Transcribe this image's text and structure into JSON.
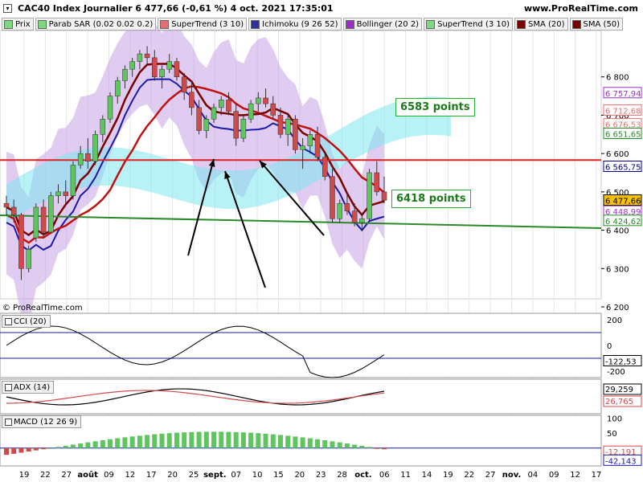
{
  "header": {
    "title": "CAC40 Index Journalier 6 477,66 (-0,61 %) 4 oct. 2021 17:35:01",
    "site": "www.ProRealTime.com",
    "copyright": "© ProRealTime.com"
  },
  "legend": [
    {
      "label": "Prix",
      "color": "#7fd87f"
    },
    {
      "label": "Parab SAR (0.02 0.02 0.2)",
      "color": "#7fd87f"
    },
    {
      "label": "SuperTrend (3 10)",
      "color": "#e07070"
    },
    {
      "label": "Ichimoku (9 26 52)",
      "color": "#3030a0"
    },
    {
      "label": "Bollinger (20 2)",
      "color": "#9b30c8"
    },
    {
      "label": "SuperTrend (3 10)",
      "color": "#7fd87f"
    },
    {
      "label": "SMA (20)",
      "color": "#7a0000"
    },
    {
      "label": "SMA (50)",
      "color": "#7a0000"
    }
  ],
  "colors": {
    "up": "#5fc55f",
    "down": "#d04a4a",
    "kumo_bull": "#7ee8ee",
    "kumo_bear": "#c080d8",
    "bollinger": "#c7a0e6",
    "support_green": "#2a8a2a",
    "resistance_red": "#dd2222",
    "arrow": "#000000"
  },
  "annotations": {
    "resistance_label": "6583 points",
    "support_label": "6418 points"
  },
  "chart_data": {
    "type": "candlestick",
    "ylim": [
      6200,
      6900
    ],
    "y_ticks": [
      "6 800",
      "6 700",
      "6 600",
      "6 500",
      "6 400",
      "6 300",
      "6 200"
    ],
    "x_ticks": [
      "19",
      "22",
      "27",
      "août",
      "09",
      "12",
      "17",
      "20",
      "25",
      "sept.",
      "07",
      "10",
      "15",
      "20",
      "23",
      "28",
      "oct.",
      "06",
      "11",
      "14",
      "19",
      "22",
      "27",
      "nov.",
      "04",
      "09",
      "12",
      "17"
    ],
    "price_tags": [
      {
        "label": "6 757,94",
        "value": 6757.94,
        "color": "#9b30c8"
      },
      {
        "label": "6 712,68",
        "value": 6712.68,
        "color": "#e07070"
      },
      {
        "label": "6 676,53",
        "value": 6676.53,
        "color": "#e07070"
      },
      {
        "label": "6 651,65",
        "value": 6651.65,
        "color": "#2a8a2a"
      },
      {
        "label": "6 565,75",
        "value": 6565.75,
        "color": "#000080"
      },
      {
        "label": "6 477,66",
        "value": 6477.66,
        "color": "#000000",
        "highlight": true
      },
      {
        "label": "6 448,99",
        "value": 6448.99,
        "color": "#9b30c8"
      },
      {
        "label": "6 424,62",
        "value": 6424.62,
        "color": "#2a8a2a"
      }
    ],
    "levels": {
      "resistance": 6583,
      "support": 6418
    },
    "candles": [
      [
        6470,
        6490,
        6440,
        6460
      ],
      [
        6460,
        6480,
        6420,
        6440
      ],
      [
        6440,
        6445,
        6270,
        6300
      ],
      [
        6300,
        6360,
        6290,
        6350
      ],
      [
        6380,
        6470,
        6370,
        6460
      ],
      [
        6460,
        6480,
        6380,
        6395
      ],
      [
        6395,
        6500,
        6390,
        6490
      ],
      [
        6490,
        6520,
        6470,
        6500
      ],
      [
        6500,
        6530,
        6470,
        6490
      ],
      [
        6490,
        6580,
        6480,
        6570
      ],
      [
        6570,
        6620,
        6560,
        6600
      ],
      [
        6600,
        6640,
        6560,
        6580
      ],
      [
        6580,
        6660,
        6570,
        6650
      ],
      [
        6650,
        6700,
        6630,
        6690
      ],
      [
        6690,
        6760,
        6680,
        6750
      ],
      [
        6750,
        6800,
        6730,
        6790
      ],
      [
        6790,
        6830,
        6770,
        6820
      ],
      [
        6820,
        6850,
        6800,
        6840
      ],
      [
        6840,
        6870,
        6820,
        6860
      ],
      [
        6860,
        6880,
        6830,
        6850
      ],
      [
        6850,
        6870,
        6790,
        6800
      ],
      [
        6800,
        6830,
        6770,
        6820
      ],
      [
        6820,
        6860,
        6810,
        6840
      ],
      [
        6840,
        6850,
        6790,
        6800
      ],
      [
        6800,
        6810,
        6740,
        6760
      ],
      [
        6760,
        6790,
        6700,
        6720
      ],
      [
        6720,
        6740,
        6650,
        6660
      ],
      [
        6660,
        6700,
        6640,
        6690
      ],
      [
        6690,
        6730,
        6680,
        6720
      ],
      [
        6720,
        6750,
        6700,
        6740
      ],
      [
        6740,
        6760,
        6700,
        6710
      ],
      [
        6710,
        6730,
        6620,
        6640
      ],
      [
        6640,
        6700,
        6630,
        6690
      ],
      [
        6690,
        6740,
        6680,
        6730
      ],
      [
        6730,
        6760,
        6710,
        6745
      ],
      [
        6745,
        6770,
        6720,
        6730
      ],
      [
        6730,
        6750,
        6690,
        6700
      ],
      [
        6700,
        6720,
        6640,
        6650
      ],
      [
        6650,
        6700,
        6620,
        6690
      ],
      [
        6690,
        6700,
        6600,
        6610
      ],
      [
        6610,
        6640,
        6560,
        6620
      ],
      [
        6620,
        6660,
        6600,
        6650
      ],
      [
        6650,
        6670,
        6580,
        6590
      ],
      [
        6590,
        6600,
        6530,
        6540
      ],
      [
        6540,
        6560,
        6420,
        6430
      ],
      [
        6430,
        6480,
        6420,
        6470
      ],
      [
        6470,
        6500,
        6440,
        6450
      ],
      [
        6450,
        6470,
        6410,
        6420
      ],
      [
        6420,
        6440,
        6400,
        6430
      ],
      [
        6430,
        6560,
        6425,
        6550
      ],
      [
        6550,
        6580,
        6490,
        6500
      ],
      [
        6500,
        6540,
        6470,
        6478
      ]
    ],
    "cci": {
      "label": "CCI (20)",
      "ylim": [
        -250,
        250
      ],
      "ticks": [
        "200",
        "0",
        "-200"
      ],
      "last": "-122,53"
    },
    "adx": {
      "label": "ADX (14)",
      "last_adx": "29,259",
      "last_di": "26,765"
    },
    "macd": {
      "label": "MACD (12 26 9)",
      "ticks": [
        "100",
        "50",
        "0"
      ],
      "last_macd": "-12,191",
      "last_signal": "-42,143"
    }
  }
}
